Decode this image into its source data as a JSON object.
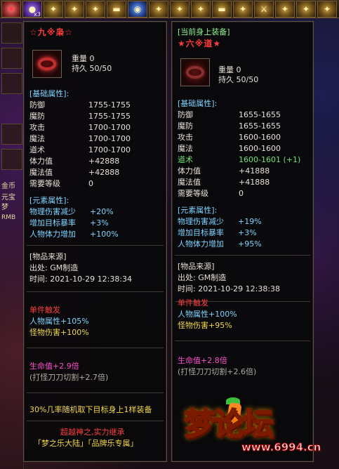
{
  "topbar": {
    "slot2_count": "x3"
  },
  "left_strip": {
    "label1": "金币",
    "label2": "元宝",
    "label3": "梦",
    "label4": "RMB"
  },
  "left_item": {
    "title": "☆九※枭☆",
    "weight": "重量  0",
    "durability": "持久  50/50",
    "base_header": "[基础属性]:",
    "base_attrs": [
      {
        "name": "防御",
        "value": "1755-1755"
      },
      {
        "name": "魔防",
        "value": "1755-1755"
      },
      {
        "name": "攻击",
        "value": "1700-1700"
      },
      {
        "name": "魔法",
        "value": "1700-1700"
      },
      {
        "name": "道术",
        "value": "1700-1700"
      },
      {
        "name": "体力值",
        "value": "+42888"
      },
      {
        "name": "魔法值",
        "value": "+42888"
      },
      {
        "name": "需要等级",
        "value": "0"
      }
    ],
    "element_header": "[元素属性]:",
    "element_attrs": [
      {
        "name": "物理伤害减少",
        "value": "+20%"
      },
      {
        "name": "增加目标暴率",
        "value": "+3%"
      },
      {
        "name": "人物体力增加",
        "value": "+100%"
      }
    ],
    "source_header": "[物品来源]",
    "source_from": "出处: GM制造",
    "source_time": "时间: 2021-10-29 12:38:34",
    "trigger_header": "单件触发",
    "trigger1": "人物属性+105%",
    "trigger2": "怪物伤害+100%",
    "hp_line": "生命值+2.9倍",
    "hp_sub": "(打怪刀刀切割+2.7倍)",
    "random_line": "30%几率随机取下目标身上1样装备",
    "footer1": "超越神之,实力继承",
    "footer2": "「梦之乐大陆」「品牌乐专属」"
  },
  "right_item": {
    "header": "[当前身上装备]",
    "title": "★六※道★",
    "weight": "重量  0",
    "durability": "持久  50/50",
    "base_header": "[基础属性]:",
    "base_attrs": [
      {
        "name": "防御",
        "value": "1655-1655"
      },
      {
        "name": "魔防",
        "value": "1655-1655"
      },
      {
        "name": "攻击",
        "value": "1600-1600"
      },
      {
        "name": "魔法",
        "value": "1600-1600"
      },
      {
        "name": "道术",
        "value": "1600-1601 (+1)"
      },
      {
        "name": "体力值",
        "value": "+41888"
      },
      {
        "name": "魔法值",
        "value": "+41888"
      },
      {
        "name": "需要等级",
        "value": "0"
      }
    ],
    "element_header": "[元素属性]:",
    "element_attrs": [
      {
        "name": "物理伤害减少",
        "value": "+19%"
      },
      {
        "name": "增加目标暴率",
        "value": "+3%"
      },
      {
        "name": "人物体力增加",
        "value": "+95%"
      }
    ],
    "source_header": "[物品来源]",
    "source_from": "出处: GM制造",
    "source_time": "时间: 2021-10-29 12:38:38",
    "trigger_header": "单件触发",
    "trigger1": "人物属性+100%",
    "trigger2": "怪物伤害+95%",
    "hp_line": "生命值+2.8倍",
    "hp_sub": "(打怪刀刀切割+2.6倍)"
  },
  "watermark": {
    "logo": "梦论坛",
    "url": "www.6994.cn"
  }
}
